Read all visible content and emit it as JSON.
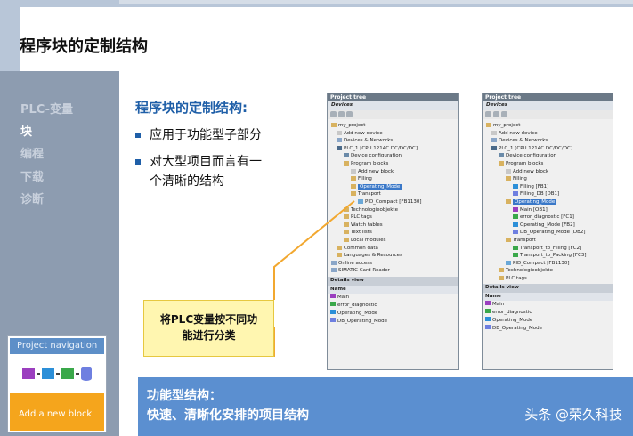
{
  "title": "程序块的定制结构",
  "sidebar": {
    "items": [
      {
        "label": "PLC-变量",
        "active": false
      },
      {
        "label": "块",
        "active": true
      },
      {
        "label": "编程",
        "active": false
      },
      {
        "label": "下载",
        "active": false
      },
      {
        "label": "诊断",
        "active": false
      }
    ]
  },
  "nav_widget": {
    "header": "Project navigation",
    "button": "Add a new block"
  },
  "content": {
    "heading": "程序块的定制结构:",
    "bullet1": "应用于功能型子部分",
    "bullet2_line1": "对大型项目而言有一",
    "bullet2_line2": "个清晰的结构"
  },
  "callout": {
    "line1": "将PLC变量按不同功",
    "line2": "能进行分类"
  },
  "bottom": {
    "line1": "功能型结构：",
    "line2": "快速、清晰化安排的项目结构",
    "watermark": "头条 @荣久科技"
  },
  "left_panel": {
    "header": "Project tree",
    "tab": "Devices",
    "tree": [
      "my_project",
      "Add new device",
      "Devices & Networks",
      "PLC_1 [CPU 1214C DC/DC/DC]",
      "Device configuration",
      "Program blocks",
      "Add new block",
      "Filling",
      "Operating_Mode",
      "Transport",
      "PID_Compact [FB1130]",
      "Technologieobjekte",
      "PLC tags",
      "Watch tables",
      "Text lists",
      "Local modules",
      "Common data",
      "Languages & Resources",
      "Online access",
      "SIMATIC Card Reader"
    ],
    "details_header": "Details view",
    "details_col": "Name",
    "details": [
      "Main",
      "error_diagnostic",
      "Operating_Mode",
      "DB_Operating_Mode"
    ]
  },
  "right_panel": {
    "header": "Project tree",
    "tab": "Devices",
    "tree": [
      "my_project",
      "Add new device",
      "Devices & Networks",
      "PLC_1 [CPU 1214C DC/DC/DC]",
      "Device configuration",
      "Program blocks",
      "Add new block",
      "Filling",
      "Filling [FB1]",
      "Filling_DB [DB1]",
      "Operating_Mode",
      "Main [OB1]",
      "error_diagnostic [FC1]",
      "Operating_Mode [FB2]",
      "DB_Operating_Mode [DB2]",
      "Transport",
      "Transport_to_Filling [FC2]",
      "Transport_to_Packing [FC3]",
      "PID_Compact [FB1130]",
      "Technologieobjekte",
      "PLC tags"
    ],
    "details_header": "Details view",
    "details_col": "Name",
    "details": [
      "Main",
      "error_diagnostic",
      "Operating_Mode",
      "DB_Operating_Mode"
    ]
  },
  "colors": {
    "accent_blue": "#1f5fa8",
    "bottom_band": "#5b8fd0",
    "callout_fill": "#fff6b0",
    "callout_line": "#f2a830",
    "sidebar": "#8d9cb0"
  }
}
